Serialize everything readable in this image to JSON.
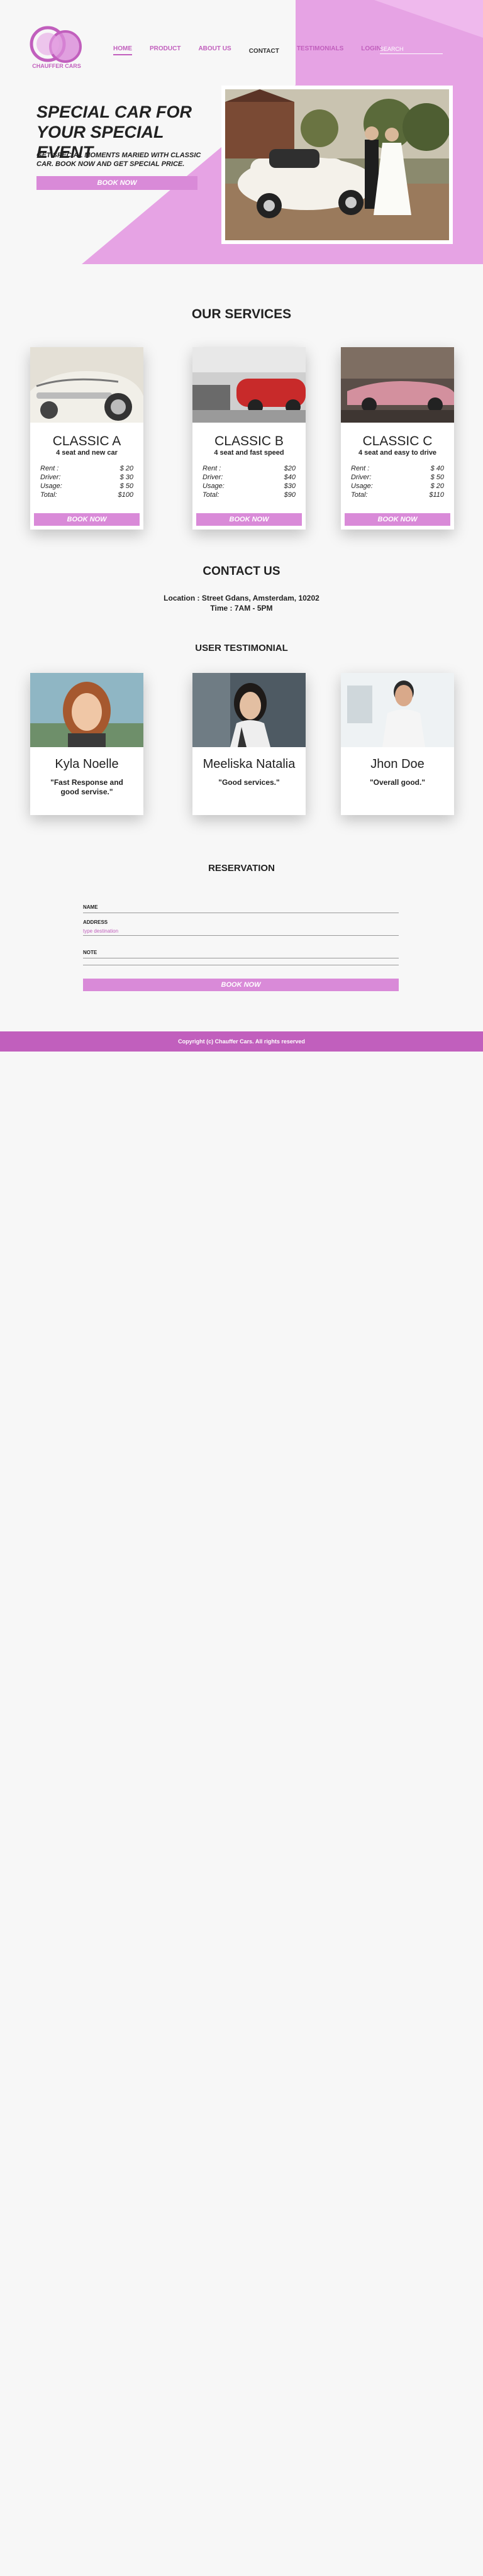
{
  "brand": {
    "name": "CHAUFFER CARS",
    "accent": "#d98ad8",
    "accent_dark": "#c15fbd"
  },
  "nav": {
    "items": [
      "HOME",
      "PRODUCT",
      "ABOUT US",
      "CONTACT",
      "TESTIMONIALS",
      "LOGIN"
    ],
    "active": "HOME",
    "search_placeholder": "SEARCH"
  },
  "hero": {
    "title": "SPECIAL CAR FOR YOUR SPECIAL EVENT",
    "subtitle": "GET SPECIAL MOMENTS MARIED WITH CLASSIC CAR. BOOK NOW AND GET SPECIAL PRICE.",
    "button": "BOOK NOW",
    "photo_icon": "wedding-car-photo"
  },
  "services": {
    "title": "OUR SERVICES",
    "cards": [
      {
        "name": "CLASSIC A",
        "desc": "4 seat and new car",
        "rent": "$ 20",
        "driver": "$ 30",
        "usage": "$ 50",
        "total": "$100",
        "button": "BOOK NOW"
      },
      {
        "name": "CLASSIC  B",
        "desc": "4 seat and fast speed",
        "rent": "$20",
        "driver": "$40",
        "usage": "$30",
        "total": "$90",
        "button": "BOOK NOW"
      },
      {
        "name": "CLASSIC C",
        "desc": "4 seat and easy to drive",
        "rent": "$ 40",
        "driver": "$ 50",
        "usage": "$ 20",
        "total": "$110",
        "button": "BOOK NOW"
      }
    ],
    "labels": {
      "rent": "Rent   :",
      "driver": "Driver:",
      "usage": "Usage:",
      "total": "Total:"
    }
  },
  "contact": {
    "title": "CONTACT US",
    "location": "Location :  Street Gdans, Amsterdam, 10202",
    "time": "Time :  7AM - 5PM"
  },
  "testimonials": {
    "title": "USER TESTIMONIAL",
    "cards": [
      {
        "name": "Kyla Noelle",
        "quote": "\"Fast Response and good servise.\""
      },
      {
        "name": "Meeliska Natalia",
        "quote": "\"Good services.\""
      },
      {
        "name": "Jhon Doe",
        "quote": "\"Overall good.\""
      }
    ]
  },
  "reservation": {
    "title": "RESERVATION",
    "name_label": "NAME",
    "address_label": "ADDRESS",
    "address_placeholder": "type destination",
    "note_label": "NOTE",
    "button": "BOOK NOW"
  },
  "footer": {
    "copyright": "Copyright (c) Chauffer Cars. All rights reserved"
  }
}
